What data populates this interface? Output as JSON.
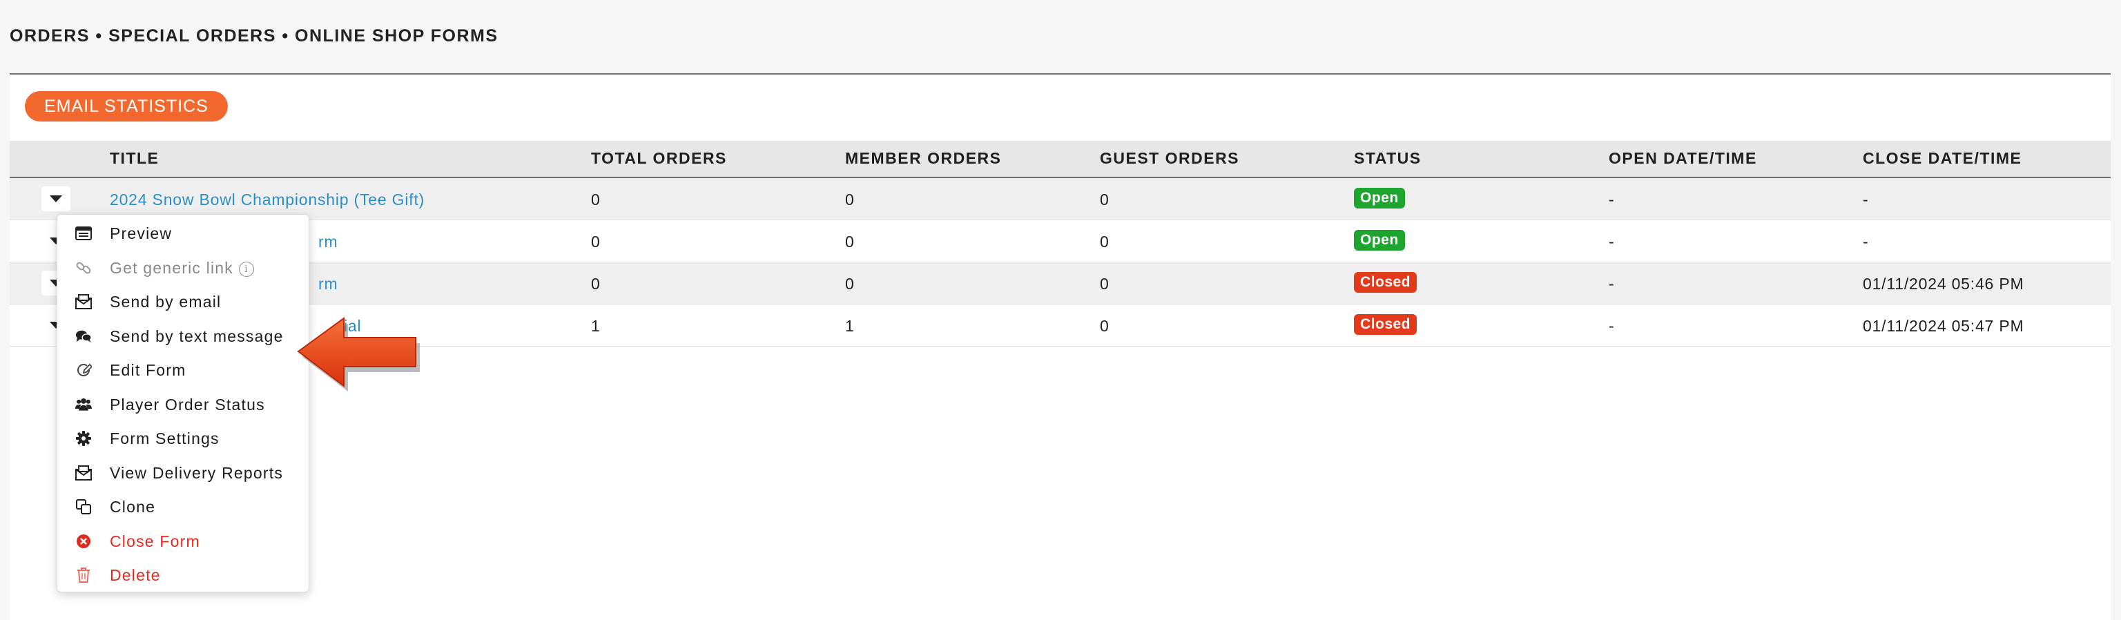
{
  "breadcrumb": "ORDERS • SPECIAL ORDERS • ONLINE SHOP FORMS",
  "toolbar": {
    "email_stats_label": "EMAIL STATISTICS"
  },
  "table": {
    "columns": {
      "title": "TITLE",
      "total_orders": "TOTAL ORDERS",
      "member_orders": "MEMBER ORDERS",
      "guest_orders": "GUEST ORDERS",
      "status": "STATUS",
      "open_datetime": "OPEN DATE/TIME",
      "close_datetime": "CLOSE DATE/TIME"
    },
    "rows": [
      {
        "title": "2024 Snow Bowl Championship (Tee Gift)",
        "total_orders": "0",
        "member_orders": "0",
        "guest_orders": "0",
        "status": "Open",
        "open_datetime": "-",
        "close_datetime": "-"
      },
      {
        "title": "rm",
        "total_orders": "0",
        "member_orders": "0",
        "guest_orders": "0",
        "status": "Open",
        "open_datetime": "-",
        "close_datetime": "-"
      },
      {
        "title": "rm",
        "total_orders": "0",
        "member_orders": "0",
        "guest_orders": "0",
        "status": "Closed",
        "open_datetime": "-",
        "close_datetime": "01/11/2024 05:46 PM"
      },
      {
        "title": "ial",
        "total_orders": "1",
        "member_orders": "1",
        "guest_orders": "0",
        "status": "Closed",
        "open_datetime": "-",
        "close_datetime": "01/11/2024 05:47 PM"
      }
    ]
  },
  "row_menu": {
    "items": [
      {
        "label": "Preview",
        "icon": "preview-icon"
      },
      {
        "label": "Get generic link",
        "icon": "link-icon",
        "info": "i"
      },
      {
        "label": "Send by email",
        "icon": "envelope-icon"
      },
      {
        "label": "Send by text message",
        "icon": "chat-bubbles-icon"
      },
      {
        "label": "Edit Form",
        "icon": "edit-icon"
      },
      {
        "label": "Player Order Status",
        "icon": "users-icon"
      },
      {
        "label": "Form Settings",
        "icon": "gear-icon"
      },
      {
        "label": "View Delivery Reports",
        "icon": "envelope-report-icon"
      },
      {
        "label": "Clone",
        "icon": "clone-icon"
      },
      {
        "label": "Close Form",
        "icon": "close-circle-icon"
      },
      {
        "label": "Delete",
        "icon": "trash-icon"
      }
    ]
  },
  "colors": {
    "accent": "#f2682f",
    "link": "#2a8fc7",
    "status_open": "#1ea52f",
    "status_closed": "#e23a1b",
    "danger": "#e02b20",
    "annotation_arrow": "#e8431c"
  }
}
